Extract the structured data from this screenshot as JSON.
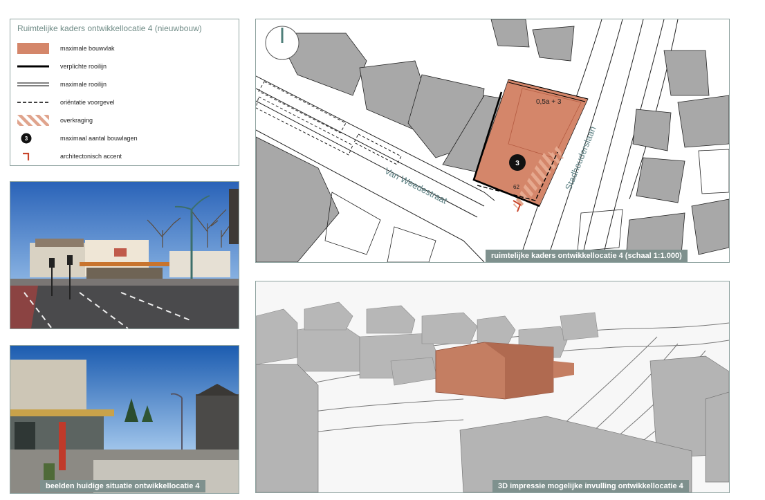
{
  "legend": {
    "title": "Ruimtelijke kaders ontwikkellocatie 4 (nieuwbouw)",
    "items": [
      {
        "label": "maximale bouwvlak",
        "icon": "filled-area-swatch"
      },
      {
        "label": "verplichte rooilijn",
        "icon": "thick-line-swatch"
      },
      {
        "label": "maximale rooilijn",
        "icon": "double-line-swatch"
      },
      {
        "label": "oriëntatie voorgevel",
        "icon": "dashed-line-swatch"
      },
      {
        "label": "overkraging",
        "icon": "hatched-swatch"
      },
      {
        "label": "maximaal aantal bouwlagen",
        "icon": "black-circle-3",
        "badge": "3"
      },
      {
        "label": "architectonisch accent",
        "icon": "corner-accent-swatch"
      }
    ]
  },
  "colors": {
    "bouwvlak": "#d4866a",
    "accent": "#c8442a",
    "building": "#a8a8a8",
    "caption_bg": "#7f918e"
  },
  "map": {
    "street_1": "Van Weedestraat",
    "street_2": "Stadhouderslaan",
    "height_label": "0,5a + 3",
    "floors_badge": "3",
    "dimension_label": "62",
    "caption": "ruimtelijke kaders ontwikkellocatie 4 (schaal 1:1.000)"
  },
  "photo_1": {
    "caption": ""
  },
  "photo_2": {
    "caption": "beelden huidige situatie ontwikkellocatie 4"
  },
  "impression": {
    "caption": "3D impressie mogelijke invulling ontwikkellocatie 4"
  }
}
